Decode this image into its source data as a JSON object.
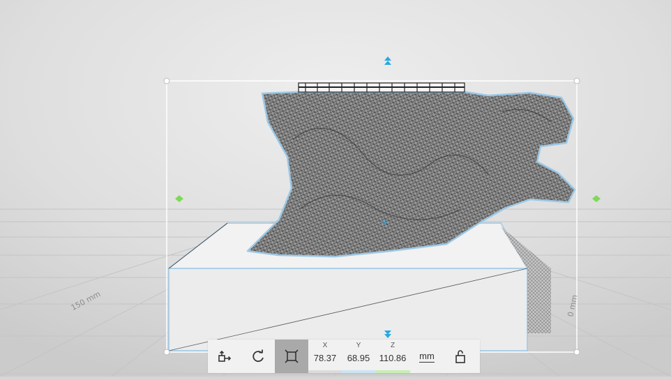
{
  "viewport": {
    "axis_left_label": "150 mm",
    "axis_right_label": "0 mm"
  },
  "toolbar": {
    "buttons": [
      {
        "name": "move-button",
        "icon": "move-icon"
      },
      {
        "name": "rotate-button",
        "icon": "rotate-icon"
      },
      {
        "name": "scale-button",
        "icon": "scale-icon",
        "active": true
      }
    ],
    "x_label": "X",
    "x_value": "78.37",
    "y_label": "Y",
    "y_value": "68.95",
    "z_label": "Z",
    "z_value": "110.86",
    "unit": "mm",
    "lock_icon": "unlock-icon"
  },
  "colors": {
    "selection_handle": "#29a8e0",
    "width_handle": "#7ed957",
    "x_accent": "#dcdcdc",
    "y_accent": "#cfe4f2",
    "z_accent": "#c9eeb5",
    "active_tool": "#a9a9a9"
  }
}
